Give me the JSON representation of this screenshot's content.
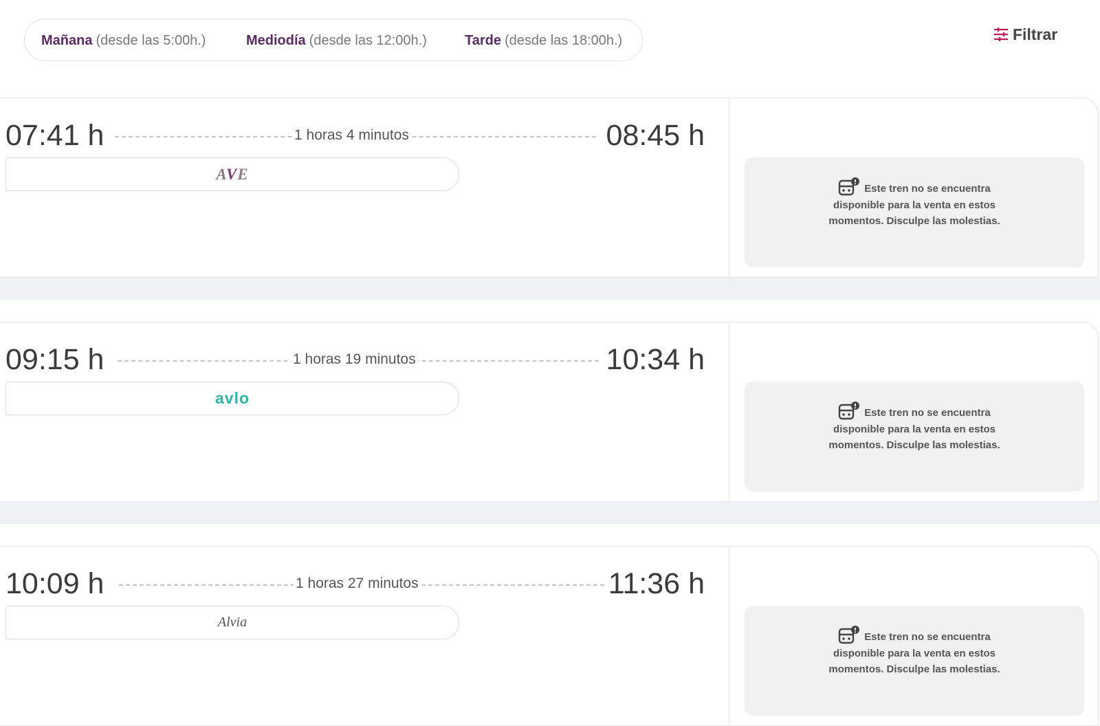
{
  "time_filter": {
    "options": [
      {
        "label": "Mañana",
        "hint": "(desde las 5:00h.)"
      },
      {
        "label": "Mediodía",
        "hint": "(desde las 12:00h.)"
      },
      {
        "label": "Tarde",
        "hint": "(desde las 18:00h.)"
      }
    ]
  },
  "filter_button": {
    "label": "Filtrar",
    "icon": "sliders-icon"
  },
  "trains": [
    {
      "departure": "07:41 h",
      "duration": "1 horas 4 minutos",
      "arrival": "08:45 h",
      "brand": "AVE",
      "notice": "Este tren no se encuentra disponible para la venta en estos momentos. Disculpe las molestias."
    },
    {
      "departure": "09:15 h",
      "duration": "1 horas 19 minutos",
      "arrival": "10:34 h",
      "brand": "avlo",
      "notice": "Este tren no se encuentra disponible para la venta en estos momentos. Disculpe las molestias."
    },
    {
      "departure": "10:09 h",
      "duration": "1 horas 27 minutos",
      "arrival": "11:36 h",
      "brand": "Alvia",
      "notice": "Este tren no se encuentra disponible para la venta en estos momentos. Disculpe las molestias."
    }
  ],
  "colors": {
    "accent": "#5b2a66",
    "filter_icon": "#c2185b",
    "avlo": "#2bb7a5",
    "separator": "#eef1f5"
  }
}
